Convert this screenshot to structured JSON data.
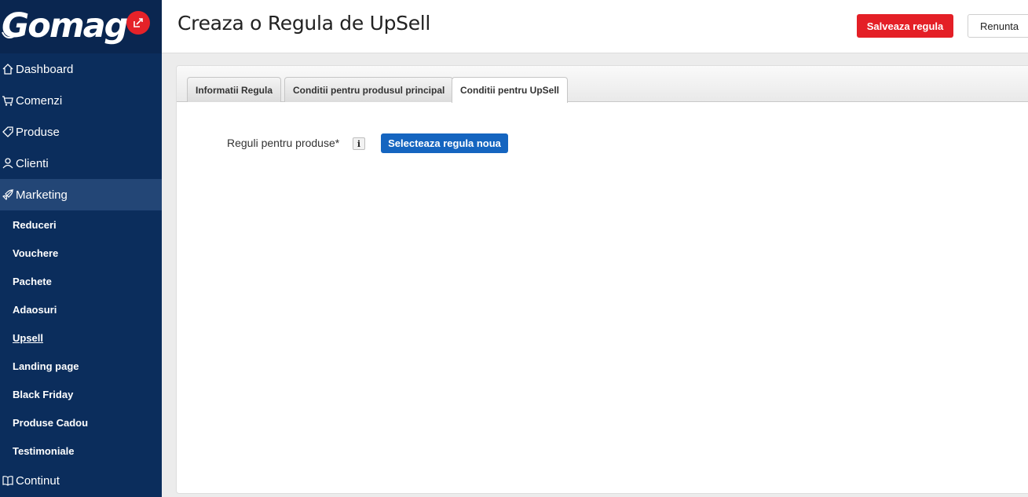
{
  "brand": {
    "logo_text": "Gomag",
    "accent": "#e52229"
  },
  "sidebar": {
    "items": [
      {
        "label": "Dashboard",
        "icon": "home-icon"
      },
      {
        "label": "Comenzi",
        "icon": "cart-icon"
      },
      {
        "label": "Produse",
        "icon": "tag-icon"
      },
      {
        "label": "Clienti",
        "icon": "user-icon"
      },
      {
        "label": "Marketing",
        "icon": "rocket-icon",
        "active": true
      }
    ],
    "subitems": [
      {
        "label": "Reduceri"
      },
      {
        "label": "Vouchere"
      },
      {
        "label": "Pachete"
      },
      {
        "label": "Adaosuri"
      },
      {
        "label": "Upsell",
        "current": true
      },
      {
        "label": "Landing page"
      },
      {
        "label": "Black Friday"
      },
      {
        "label": "Produse Cadou"
      },
      {
        "label": "Testimoniale"
      }
    ],
    "bottom_item": {
      "label": "Continut",
      "icon": "book-icon"
    },
    "background": "#0b2d5c"
  },
  "header": {
    "title": "Creaza o Regula de UpSell",
    "save_label": "Salveaza regula",
    "cancel_label": "Renunta"
  },
  "tabs": [
    {
      "label": "Informatii Regula"
    },
    {
      "label": "Conditii pentru produsul principal"
    },
    {
      "label": "Conditii pentru UpSell",
      "active": true
    }
  ],
  "form": {
    "field_label": "Reguli pentru produse*",
    "info_label": "i",
    "select_label": "Selecteaza regula noua"
  }
}
